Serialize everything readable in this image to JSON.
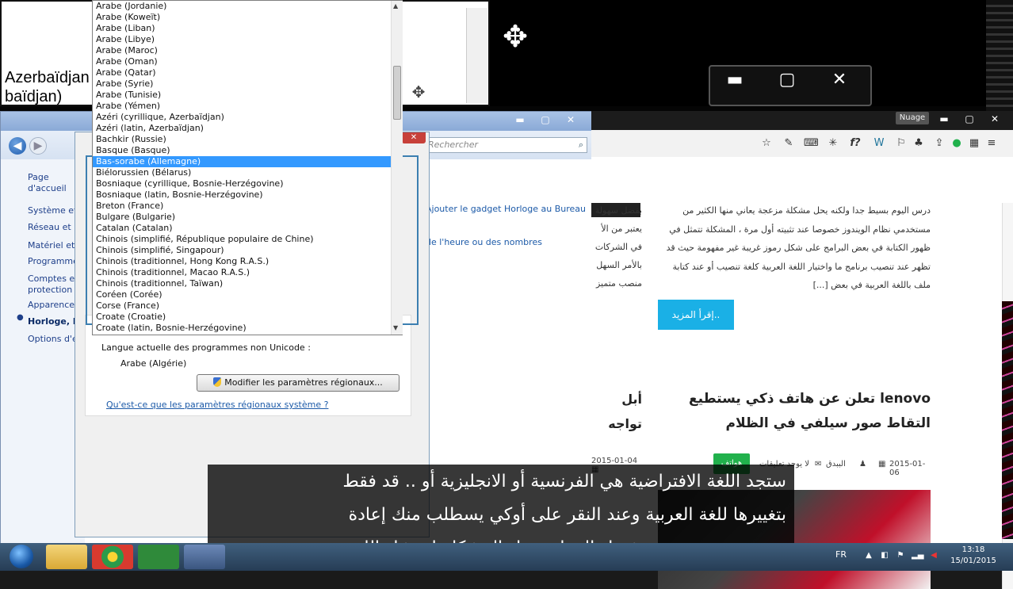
{
  "top_window": {
    "text_line1": "Azerbaïdjan",
    "text_line2": "baïdjan)"
  },
  "window_controls": {
    "minimize": "▬",
    "maximize": "▢",
    "close": "✕"
  },
  "control_panel": {
    "search_placeholder": "Rechercher",
    "left_nav": [
      "Page d'accueil du Panneau de configuration",
      "Système et sécurité",
      "Réseau et Internet",
      "Matériel et audio",
      "Programmes",
      "Comptes et protection des utilisateurs",
      "Apparence et personnalisation",
      "Horloge, langue et région",
      "Options d'ergonomie"
    ],
    "main_link1": "Ajouter le gadget Horloge au Bureau",
    "main_link2": "de l'heure ou des nombres"
  },
  "region_dialog": {
    "unicode_label": "Langue actuelle des programmes non Unicode :",
    "unicode_value": "Arabe (Algérie)",
    "modify_button": "Modifier les paramètres régionaux...",
    "help_link": "Qu'est-ce que les paramètres régionaux système ?"
  },
  "dropdown": {
    "selected": "Bas-sorabe (Allemagne)",
    "options": [
      "Arabe (Jordanie)",
      "Arabe (Koweït)",
      "Arabe (Liban)",
      "Arabe (Libye)",
      "Arabe (Maroc)",
      "Arabe (Oman)",
      "Arabe (Qatar)",
      "Arabe (Syrie)",
      "Arabe (Tunisie)",
      "Arabe (Yémen)",
      "Azéri (cyrillique, Azerbaïdjan)",
      "Azéri (latin, Azerbaïdjan)",
      "Bachkir (Russie)",
      "Basque (Basque)",
      "Bas-sorabe (Allemagne)",
      "Biélorussien (Bélarus)",
      "Bosniaque (cyrillique, Bosnie-Herzégovine)",
      "Bosniaque (latin, Bosnie-Herzégovine)",
      "Breton (France)",
      "Bulgare (Bulgarie)",
      "Catalan (Catalan)",
      "Chinois (simplifié, République populaire de Chine)",
      "Chinois (simplifié, Singapour)",
      "Chinois (traditionnel, Hong Kong R.A.S.)",
      "Chinois (traditionnel, Macao R.A.S.)",
      "Chinois (traditionnel, Taïwan)",
      "Coréen (Corée)",
      "Corse (France)",
      "Croate (Croatie)",
      "Croate (latin, Bosnie-Herzégovine)"
    ]
  },
  "browser": {
    "cloud_button": "Nuage",
    "paragraph": "درس اليوم بسيط جدا ولكنه يحل مشكلة مزعجة يعاني منها الكثير من مستخدمي نظام الويندوز خصوصا عند تثبيته أول مرة ، المشكلة تتمثل في ظهور الكتابة في بعض البرامج على شكل رموز غريبة غير مفهومة حيث قد تظهر عند تنصيب برنامج ما واختيار اللغة العربية كلغة تنصيب أو عند كتابة ملف باللغة العربية في بعض [...]",
    "read_more": "إقرأ المزيد..",
    "article_title": "lenovo تعلن عن هاتف ذكي يستطيع التقاط صور سيلفي في الظلام",
    "date": "2015-01-06",
    "author": "الببدق",
    "comments": "لا يوجد تعليقات",
    "tag": "هواتف",
    "left_col_text": "بفضل سهولة يعتبر من الأ في الشركات بالأمر السهل منصب متميز",
    "left_title": "أبل تواجه لتحديث",
    "left_date": "2015-01-04"
  },
  "subtitles": [
    "ستجد اللغة الافتراضية هي الفرنسية أو الانجليزية أو .. قد فقط",
    "بتغييرها للغة العربية وعند النقر على أوكي يسطلب منك إعادة",
    "تشغيل الجهاز وتحل المشكلة إن شاء الله"
  ],
  "taskbar": {
    "lang": "FR",
    "time": "13:18",
    "date": "15/01/2015"
  },
  "colors": {
    "selection": "#3399ff",
    "read_more_bg": "#1ab0e6",
    "tag_bg": "#21b14c",
    "link": "#1c5aa8"
  }
}
